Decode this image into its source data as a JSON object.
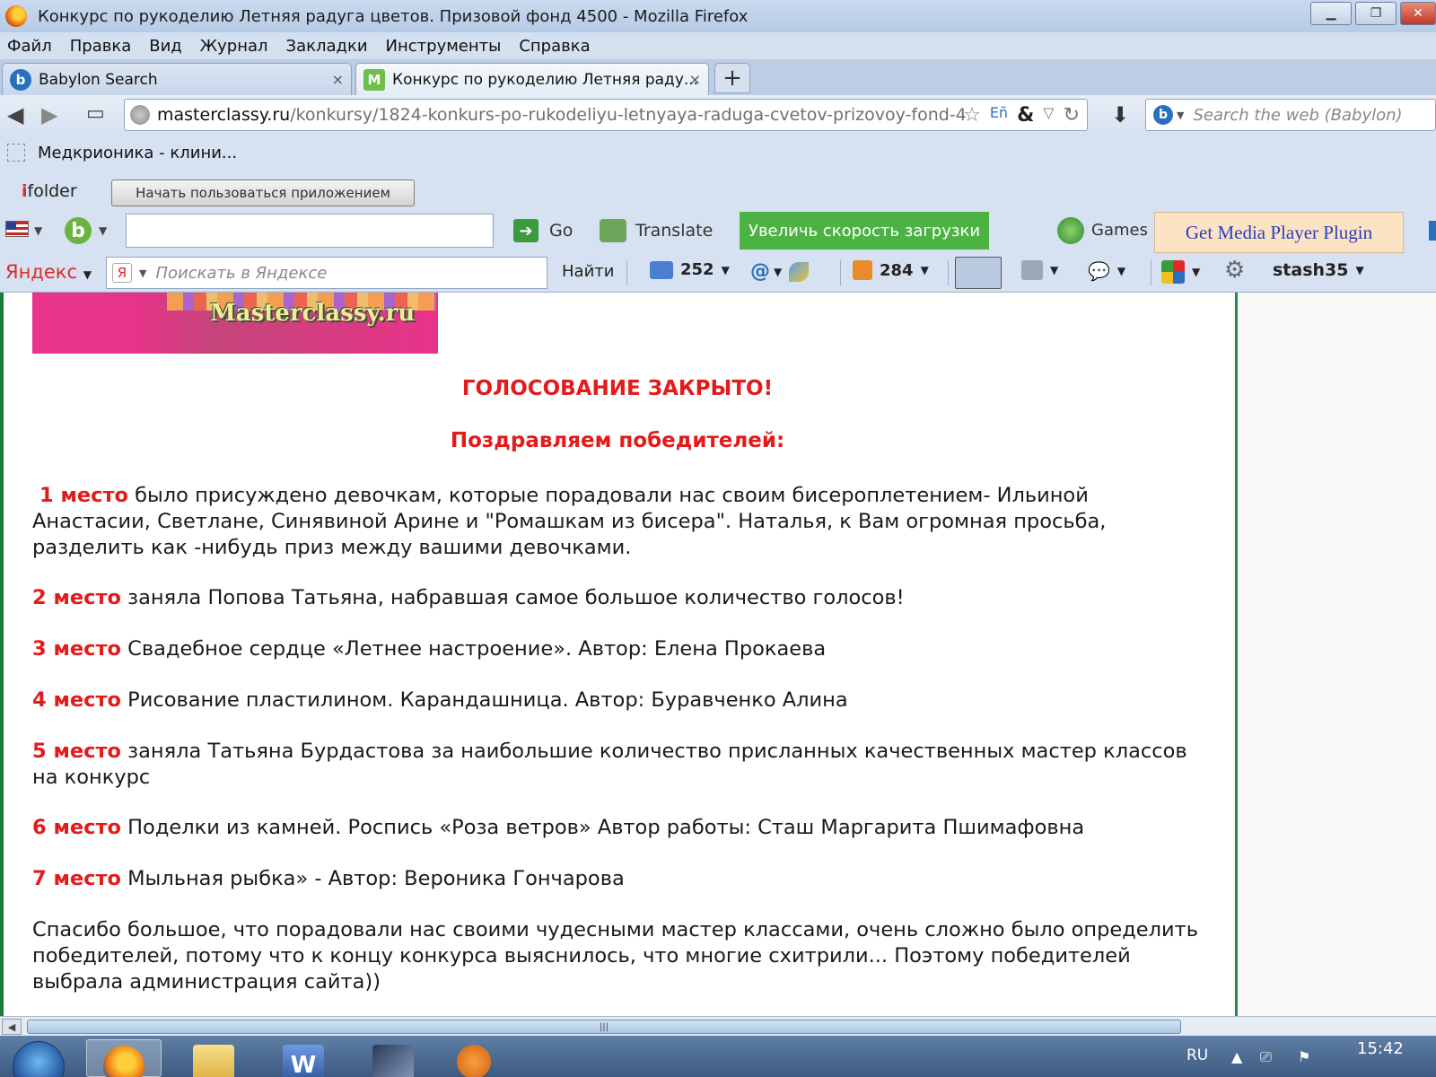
{
  "window": {
    "title": "Конкурс по рукоделию Летняя радуга цветов. Призовой фонд 4500 - Mozilla Firefox",
    "controls": [
      "minimize",
      "restore",
      "close"
    ]
  },
  "menu": [
    "Файл",
    "Правка",
    "Вид",
    "Журнал",
    "Закладки",
    "Инструменты",
    "Справка"
  ],
  "tabs": [
    {
      "label": "Babylon Search",
      "icon": "babylon-icon",
      "close": "×",
      "active": false
    },
    {
      "label": "Конкурс по рукоделию Летняя раду...",
      "icon": "masterclassy-icon",
      "close": "×",
      "active": true
    }
  ],
  "new_tab_label": "+",
  "navigation": {
    "url_domain": "masterclassy.ru",
    "url_path": "/konkursy/1824-konkurs-po-rukodeliyu-letnyaya-raduga-cvetov-prizovoy-fond-4",
    "search_placeholder": "Search the web (Babylon)"
  },
  "bookmarks": [
    {
      "label": "Медкрионика - клини..."
    }
  ],
  "ifolder": {
    "logo": "folder",
    "button_label": "Начать пользоваться приложением"
  },
  "babylon_toolbar": {
    "go_label": "Go",
    "translate_label": "Translate",
    "speed_button": "Увеличь скорость загрузки",
    "games_label": "Games",
    "media_plugin": "Get Media Player Plugin"
  },
  "yandex_toolbar": {
    "logo": "Яндекс",
    "search_placeholder": "Поискать в Яндексе",
    "find_label": "Найти",
    "mail_count": "252",
    "box_count": "284",
    "user": "stash35"
  },
  "page": {
    "banner_text": "Masterclassy.ru",
    "closed_heading": "ГОЛОСОВАНИЕ ЗАКРЫТО!",
    "congrats_heading": "Поздравляем победителей:",
    "places": [
      {
        "place": "1 место",
        "text": " было присуждено девочкам, которые порадовали нас своим бисероплетением- Ильиной Анастасии, Светлане, Синявиной Арине и \"Ромашкам из бисера\". Наталья, к Вам огромная просьба, разделить как -нибудь приз между вашими девочками."
      },
      {
        "place": "2 место",
        "text": " заняла Попова Татьяна, набравшая самое большое количество голосов!"
      },
      {
        "place": "3 место",
        "text": " Свадебное сердце «Летнее настроение». Автор: Елена Прокаева"
      },
      {
        "place": "4 место",
        "text": " Рисование пластилином. Карандашница. Автор:  Буравченко Алина"
      },
      {
        "place": "5 место",
        "text": " заняла Татьяна Бурдастова  за наибольшие количество присланных качественных мастер классов на конкурс"
      },
      {
        "place": "6 место",
        "text": " Поделки из камней. Роспись «Роза ветров» Автор работы: Сташ Маргарита Пшимафовна"
      },
      {
        "place": "7 место",
        "text": " Мыльная рыбка» -  Автор: Вероника Гончарова"
      }
    ],
    "closing": "Спасибо большое, что порадовали нас своими чудесными мастер классами, очень сложно было определить победителей, потому что к концу конкурса выяснилось, что многие схитрили... Поэтому победителей выбрала администрация сайта))"
  },
  "taskbar": {
    "apps": [
      "firefox-icon",
      "explorer-icon",
      "word-icon",
      "paint-icon",
      "media-player-icon"
    ],
    "language": "RU",
    "time": "15:42"
  },
  "colors": {
    "accent_red": "#e31b1b",
    "green_button": "#4cb244",
    "page_border_green": "#1a7a3a"
  }
}
